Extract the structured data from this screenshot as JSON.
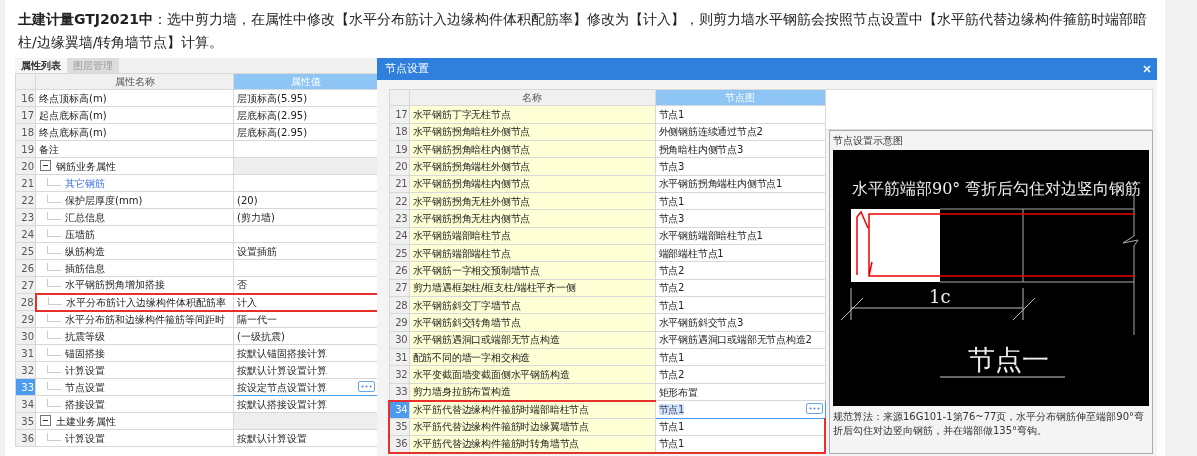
{
  "article": {
    "intro": "**土建计量GTJ2021中**：选中剪力墙，在属性中修改【水平分布筋计入边缘构件体积配筋率】修改为【计入】，则剪力墙水平钢筋会按照节点设置中【水平筋代替边缘构件箍筋时端部暗柱/边缘翼墙/转角墙节点】计算。"
  },
  "property_panel": {
    "tabs": [
      {
        "label": "属性列表",
        "selected": true
      },
      {
        "label": "图层管理",
        "selected": false
      }
    ],
    "columns": [
      "属性名称",
      "属性值"
    ],
    "rows": [
      {
        "number": "16",
        "name": "终点顶标高(m)",
        "value": "层顶标高(5.95)",
        "kind": "field",
        "selected": false,
        "boxed": false
      },
      {
        "number": "17",
        "name": "起点底标高(m)",
        "value": "层底标高(2.95)",
        "kind": "field",
        "selected": false,
        "boxed": false
      },
      {
        "number": "18",
        "name": "终点底标高(m)",
        "value": "层底标高(2.95)",
        "kind": "field",
        "selected": false,
        "boxed": false
      },
      {
        "number": "19",
        "name": "备注",
        "kind": "field",
        "selected": false,
        "boxed": false
      },
      {
        "number": "20",
        "name": "钢筋业务属性",
        "kind": "group",
        "expanded": true,
        "selected": false,
        "boxed": false,
        "children": [
          {
            "number": "21",
            "name": "其它钢筋",
            "kind": "link",
            "selected": false,
            "boxed": false
          },
          {
            "number": "22",
            "name": "保护层厚度(mm)",
            "value": "(20)",
            "kind": "field",
            "selected": false,
            "boxed": false
          },
          {
            "number": "23",
            "name": "汇总信息",
            "value": "(剪力墙)",
            "kind": "field",
            "selected": false,
            "boxed": false
          },
          {
            "number": "24",
            "name": "压墙筋",
            "kind": "field",
            "selected": false,
            "boxed": false
          },
          {
            "number": "25",
            "name": "纵筋构造",
            "value": "设置插筋",
            "kind": "field",
            "selected": false,
            "boxed": false
          },
          {
            "number": "26",
            "name": "插筋信息",
            "kind": "field",
            "selected": false,
            "boxed": false
          },
          {
            "number": "27",
            "name": "水平钢筋拐角增加搭接",
            "value": "否",
            "kind": "field",
            "selected": false,
            "boxed": false
          },
          {
            "number": "28",
            "name": "水平分布筋计入边缘构件体积配筋率",
            "value": "计入",
            "kind": "field",
            "selected": false,
            "boxed": true
          },
          {
            "number": "29",
            "name": "水平分布筋和边缘构件箍筋等间距时",
            "value": "隔一代一",
            "kind": "field",
            "selected": false,
            "boxed": false
          },
          {
            "number": "30",
            "name": "抗震等级",
            "value": "(一级抗震)",
            "kind": "field",
            "selected": false,
            "boxed": false
          },
          {
            "number": "31",
            "name": "锚固搭接",
            "value": "按默认锚固搭接计算",
            "kind": "field",
            "selected": false,
            "boxed": false
          },
          {
            "number": "32",
            "name": "计算设置",
            "value": "按默认计算设置计算",
            "kind": "field",
            "selected": false,
            "boxed": false
          },
          {
            "number": "33",
            "name": "节点设置",
            "value": "按设定节点设置计算",
            "kind": "field",
            "selected": true,
            "boxed": false
          },
          {
            "number": "34",
            "name": "搭接设置",
            "value": "按默认搭接设置计算",
            "kind": "field",
            "selected": false,
            "boxed": false
          }
        ]
      },
      {
        "number": "35",
        "name": "土建业务属性",
        "kind": "group",
        "expanded": true,
        "selected": false,
        "boxed": false,
        "children": [
          {
            "number": "36",
            "name": "计算设置",
            "value": "按默认计算设置",
            "kind": "field",
            "selected": false,
            "boxed": false
          }
        ]
      }
    ]
  },
  "dialog": {
    "title": "节点设置",
    "columns": [
      "名称",
      "节点图"
    ],
    "rows": [
      {
        "number": "17",
        "name": "水平钢筋丁字无柱节点",
        "value": "节点1",
        "selected": false,
        "boxed": false
      },
      {
        "number": "18",
        "name": "水平钢筋拐角暗柱外侧节点",
        "value": "外侧钢筋连续通过节点2",
        "selected": false,
        "boxed": false
      },
      {
        "number": "19",
        "name": "水平钢筋拐角暗柱内侧节点",
        "value": "拐角暗柱内侧节点3",
        "selected": false,
        "boxed": false
      },
      {
        "number": "20",
        "name": "水平钢筋拐角端柱外侧节点",
        "value": "节点3",
        "selected": false,
        "boxed": false
      },
      {
        "number": "21",
        "name": "水平钢筋拐角端柱内侧节点",
        "value": "水平钢筋拐角端柱内侧节点1",
        "selected": false,
        "boxed": false
      },
      {
        "number": "22",
        "name": "水平钢筋拐角无柱外侧节点",
        "value": "节点1",
        "selected": false,
        "boxed": false
      },
      {
        "number": "23",
        "name": "水平钢筋拐角无柱内侧节点",
        "value": "节点3",
        "selected": false,
        "boxed": false
      },
      {
        "number": "24",
        "name": "水平钢筋端部暗柱节点",
        "value": "水平钢筋端部暗柱节点1",
        "selected": false,
        "boxed": false
      },
      {
        "number": "25",
        "name": "水平钢筋端部端柱节点",
        "value": "端部端柱节点1",
        "selected": false,
        "boxed": false
      },
      {
        "number": "26",
        "name": "水平钢筋一字相交预制墙节点",
        "value": "节点2",
        "selected": false,
        "boxed": false
      },
      {
        "number": "27",
        "name": "剪力墙遇框架柱/框支柱/端柱平齐一侧",
        "value": "节点2",
        "selected": false,
        "boxed": false
      },
      {
        "number": "28",
        "name": "水平钢筋斜交丁字墙节点",
        "value": "节点1",
        "selected": false,
        "boxed": false
      },
      {
        "number": "29",
        "name": "水平钢筋斜交转角墙节点",
        "value": "水平钢筋斜交节点3",
        "selected": false,
        "boxed": false
      },
      {
        "number": "30",
        "name": "水平钢筋遇洞口或端部无节点构造",
        "value": "水平钢筋遇洞口或端部无节点构造2",
        "selected": false,
        "boxed": false
      },
      {
        "number": "31",
        "name": "配筋不同的墙一字相交构造",
        "value": "节点1",
        "selected": false,
        "boxed": false
      },
      {
        "number": "32",
        "name": "水平变截面墙变截面侧水平钢筋构造",
        "value": "节点2",
        "selected": false,
        "boxed": false
      },
      {
        "number": "33",
        "name": "剪力墙身拉筋布置构造",
        "value": "矩形布置",
        "selected": false,
        "boxed": false
      },
      {
        "number": "34",
        "name": "水平筋代替边缘构件箍筋时端部暗柱节点",
        "value": "节点1",
        "selected": true,
        "boxed": true
      },
      {
        "number": "35",
        "name": "水平筋代替边缘构件箍筋时边缘翼墙节点",
        "value": "节点1",
        "selected": false,
        "boxed": true
      },
      {
        "number": "36",
        "name": "水平筋代替边缘构件箍筋时转角墙节点",
        "value": "节点1",
        "selected": false,
        "boxed": true
      }
    ],
    "preview": {
      "title": "节点设置示意图",
      "caption": "水平筋端部90° 弯折后勾住对边竖向钢筋",
      "dimension": "1c",
      "node_name": "节点一",
      "note": "规范算法：来源16G101-1第76~77页，水平分布钢筋伸至端部90°弯折后勾住对边竖向钢筋，并在端部做135°弯钩。"
    }
  }
}
